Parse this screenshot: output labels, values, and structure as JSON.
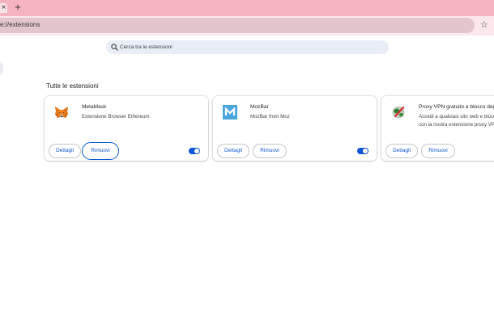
{
  "tabs": {
    "close_glyph": "×",
    "new_tab_glyph": "+"
  },
  "omnibox": {
    "url": "e://extensions",
    "bookmark_glyph": "☆"
  },
  "search": {
    "placeholder": "Cerca tra le estensioni"
  },
  "section": {
    "title": "Tutte le estensioni"
  },
  "extensions": [
    {
      "name": "MetaMask",
      "description": "Estensione Browser Ethereum",
      "details_label": "Dettagli",
      "remove_label": "Rimuovi",
      "enabled": true,
      "icon": "metamask-fox-icon"
    },
    {
      "name": "MozBar",
      "description": "MozBar from Moz",
      "details_label": "Dettagli",
      "remove_label": "Rimuovi",
      "enabled": true,
      "icon": "mozbar-m-icon"
    },
    {
      "name": "Proxy VPN gratuito e blocco degli",
      "description": "Accedi a qualsiasi sito web e blocc",
      "description_line2": "con la nostra estensione proxy VP",
      "details_label": "Dettagli",
      "remove_label": "Rimuovi",
      "icon": "proxy-vpn-globe-icon"
    }
  ],
  "colors": {
    "tabstrip": "#f4b3bf",
    "toolbar": "#fbe7ec",
    "omnibox": "#e3c6cd",
    "accent": "#0b57d0"
  }
}
